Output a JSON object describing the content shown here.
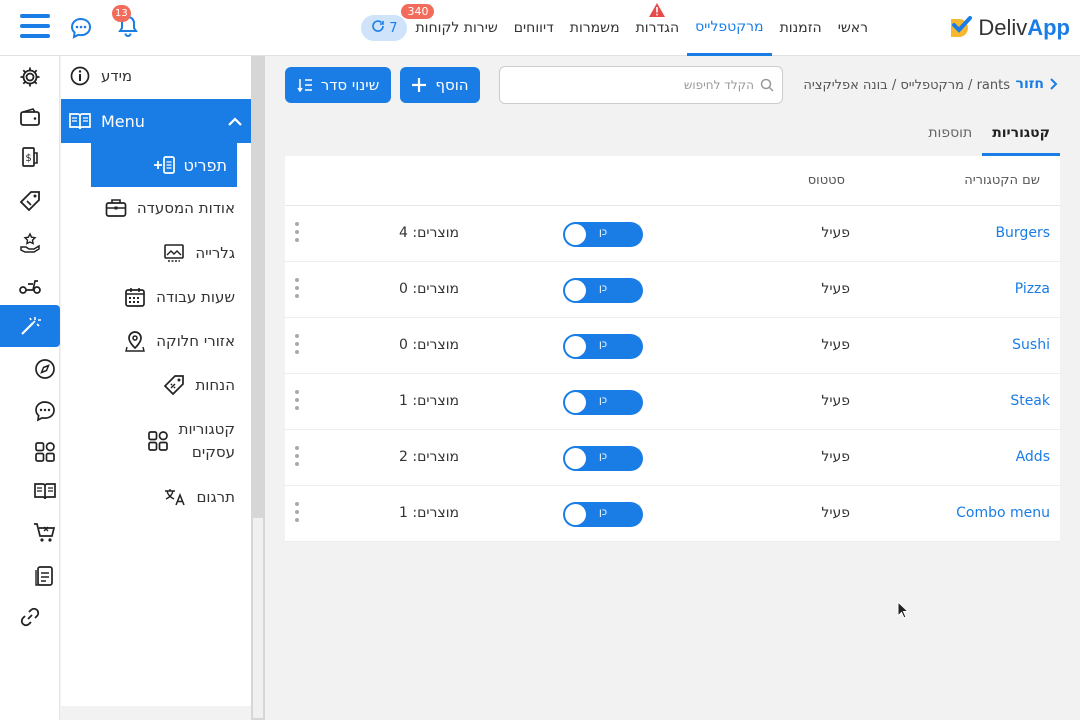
{
  "header": {
    "notification_count": "13",
    "nav": [
      {
        "label": "ראשי",
        "active": false
      },
      {
        "label": "הזמנות",
        "active": false
      },
      {
        "label": "מרקטפלייס",
        "active": true
      },
      {
        "label": "הגדרות",
        "active": false,
        "warning": true
      },
      {
        "label": "משמרות",
        "active": false
      },
      {
        "label": "דיווחים",
        "active": false
      },
      {
        "label": "שירות לקוחות",
        "active": false,
        "badge": "340"
      }
    ],
    "pill_value": "7",
    "logo": {
      "prefix": "Deliv",
      "suffix": "App"
    }
  },
  "sidebar": {
    "info_label": "מידע",
    "menu_label": "Menu",
    "active_sub": "תפריט",
    "items": [
      {
        "label": "אודות המסעדה",
        "icon": "briefcase-icon"
      },
      {
        "label": "גלרייה",
        "icon": "gallery-icon"
      },
      {
        "label": "שעות עבודה",
        "icon": "calendar-icon"
      },
      {
        "label": "אזורי חלוקה",
        "icon": "map-pin-icon"
      },
      {
        "label": "הנחות",
        "icon": "discount-tag-icon"
      },
      {
        "label": "קטגוריות",
        "label2": "עסקים",
        "icon": "grid-icon"
      },
      {
        "label": "תרגום",
        "icon": "translate-icon"
      }
    ]
  },
  "content": {
    "back_label": "חזור",
    "breadcrumb": "מרקטפלייס / בונה אפליקציה / rants",
    "search_placeholder": "הקלד לחיפוש",
    "add_label": "הוסף",
    "sort_label": "שינוי סדר",
    "tabs": [
      "קטגוריות",
      "תוספות"
    ],
    "columns": {
      "name": "שם הקטגוריה",
      "status": "סטטוס"
    },
    "toggle_label": "כן",
    "rows": [
      {
        "name": "Burgers",
        "status": "פעיל",
        "products": "מוצרים: 4"
      },
      {
        "name": "Pizza",
        "status": "פעיל",
        "products": "מוצרים: 0"
      },
      {
        "name": "Sushi",
        "status": "פעיל",
        "products": "מוצרים: 0"
      },
      {
        "name": "Steak",
        "status": "פעיל",
        "products": "מוצרים: 1"
      },
      {
        "name": "Adds",
        "status": "פעיל",
        "products": "מוצרים: 2"
      },
      {
        "name": "Combo menu",
        "status": "פעיל",
        "products": "מוצרים: 1"
      }
    ]
  },
  "colors": {
    "accent": "#1a7de6",
    "badge": "#f26b5b"
  }
}
